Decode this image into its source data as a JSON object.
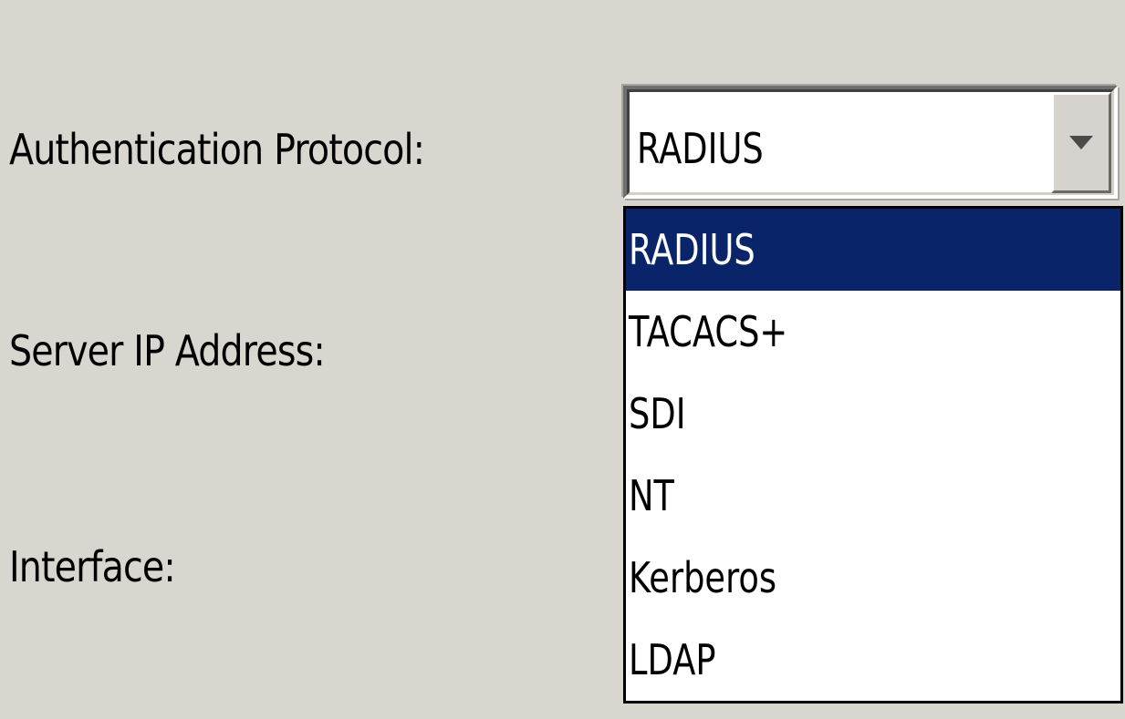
{
  "form": {
    "labels": {
      "auth_protocol": "Authentication Protocol:",
      "server_ip": "Server IP Address:",
      "interface": "Interface:"
    }
  },
  "auth_protocol": {
    "selected_value": "RADIUS",
    "arrow_icon": "dropdown-arrow-icon",
    "options": [
      "RADIUS",
      "TACACS+",
      "SDI",
      "NT",
      "Kerberos",
      "LDAP"
    ],
    "highlighted_index": 0
  },
  "colors": {
    "background": "#d9d6d0",
    "selection": "#0a246a",
    "selection_text": "#ffffff"
  }
}
